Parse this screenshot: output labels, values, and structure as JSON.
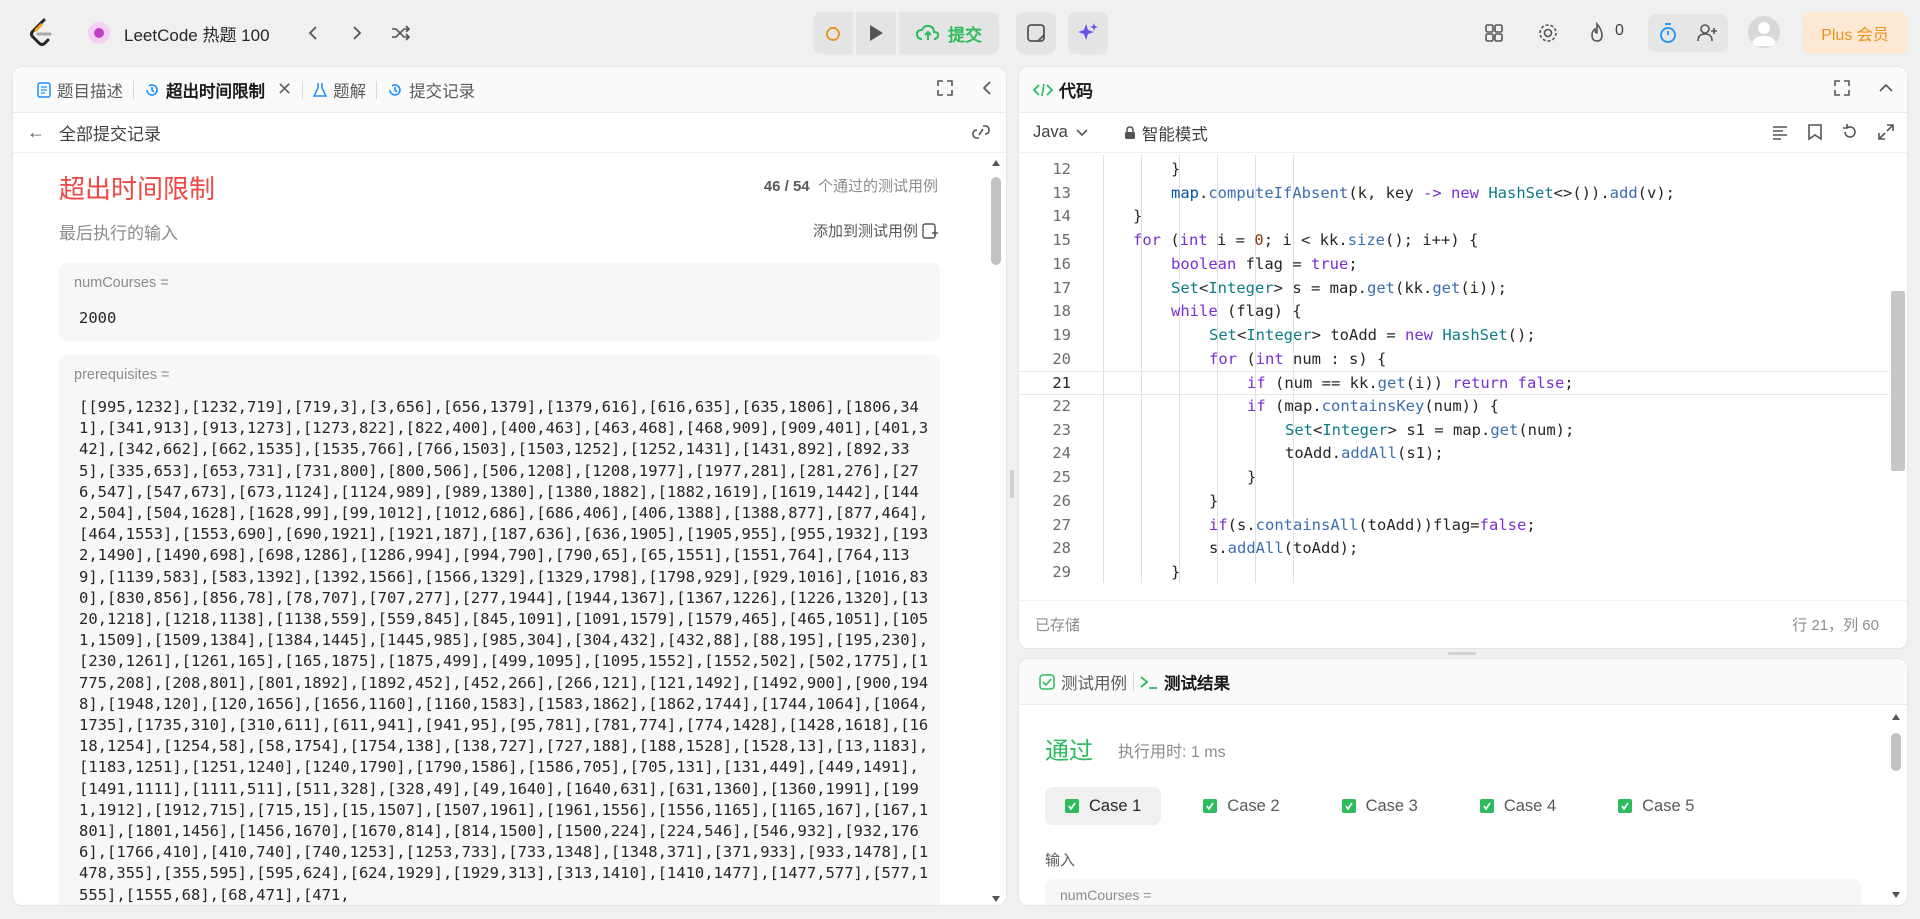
{
  "topbar": {
    "list_title": "LeetCode 热题 100",
    "submit_label": "提交",
    "fire_count": "0",
    "plus_label": "Plus 会员"
  },
  "left": {
    "tabs": [
      {
        "label": "题目描述"
      },
      {
        "label": "超出时间限制"
      },
      {
        "label": "题解"
      },
      {
        "label": "提交记录"
      }
    ],
    "back_label": "全部提交记录",
    "result_title": "超出时间限制",
    "passed": "46 / 54",
    "passed_suffix": "个通过的测试用例",
    "last_input_label": "最后执行的输入",
    "add_case_label": "添加到测试用例",
    "num_label": "numCourses =",
    "num_value": "2000",
    "prereq_label": "prerequisites =",
    "prereq_value": "[[995,1232],[1232,719],[719,3],[3,656],[656,1379],[1379,616],[616,635],[635,1806],[1806,341],[341,913],[913,1273],[1273,822],[822,400],[400,463],[463,468],[468,909],[909,401],[401,342],[342,662],[662,1535],[1535,766],[766,1503],[1503,1252],[1252,1431],[1431,892],[892,335],[335,653],[653,731],[731,800],[800,506],[506,1208],[1208,1977],[1977,281],[281,276],[276,547],[547,673],[673,1124],[1124,989],[989,1380],[1380,1882],[1882,1619],[1619,1442],[1442,504],[504,1628],[1628,99],[99,1012],[1012,686],[686,406],[406,1388],[1388,877],[877,464],[464,1553],[1553,690],[690,1921],[1921,187],[187,636],[636,1905],[1905,955],[955,1932],[1932,1490],[1490,698],[698,1286],[1286,994],[994,790],[790,65],[65,1551],[1551,764],[764,1139],[1139,583],[583,1392],[1392,1566],[1566,1329],[1329,1798],[1798,929],[929,1016],[1016,830],[830,856],[856,78],[78,707],[707,277],[277,1944],[1944,1367],[1367,1226],[1226,1320],[1320,1218],[1218,1138],[1138,559],[559,845],[845,1091],[1091,1579],[1579,465],[465,1051],[1051,1509],[1509,1384],[1384,1445],[1445,985],[985,304],[304,432],[432,88],[88,195],[195,230],[230,1261],[1261,165],[165,1875],[1875,499],[499,1095],[1095,1552],[1552,502],[502,1775],[1775,208],[208,801],[801,1892],[1892,452],[452,266],[266,121],[121,1492],[1492,900],[900,1948],[1948,120],[120,1656],[1656,1160],[1160,1583],[1583,1862],[1862,1744],[1744,1064],[1064,1735],[1735,310],[310,611],[611,941],[941,95],[95,781],[781,774],[774,1428],[1428,1618],[1618,1254],[1254,58],[58,1754],[1754,138],[138,727],[727,188],[188,1528],[1528,13],[13,1183],[1183,1251],[1251,1240],[1240,1790],[1790,1586],[1586,705],[705,131],[131,449],[449,1491],[1491,1111],[1111,511],[511,328],[328,49],[49,1640],[1640,631],[631,1360],[1360,1991],[1991,1912],[1912,715],[715,15],[15,1507],[1507,1961],[1961,1556],[1556,1165],[1165,167],[167,1801],[1801,1456],[1456,1670],[1670,814],[814,1500],[1500,224],[224,546],[546,932],[932,1766],[1766,410],[410,740],[740,1253],[1253,733],[733,1348],[1348,371],[371,933],[933,1478],[1478,355],[355,595],[595,624],[624,1929],[1929,313],[313,1410],[1410,1477],[1477,577],[577,1555],[1555,68],[68,471],[471,"
  },
  "code_panel": {
    "title": "代码",
    "language": "Java",
    "mode": "智能模式",
    "saved": "已存储",
    "cursor": "行 21，列 60",
    "lines": [
      {
        "n": "12",
        "indent": 4,
        "tokens": [
          [
            "pl",
            "}"
          ]
        ]
      },
      {
        "n": "13",
        "indent": 4,
        "tokens": [
          [
            "vr",
            "map"
          ],
          [
            "pl",
            "."
          ],
          [
            "fn",
            "computeIfAbsent"
          ],
          [
            "pl",
            "(k, key "
          ],
          [
            "kw",
            "->"
          ],
          [
            "pl",
            " "
          ],
          [
            "kw",
            "new"
          ],
          [
            "pl",
            " "
          ],
          [
            "ty",
            "HashSet"
          ],
          [
            "pl",
            "<>())."
          ],
          [
            "fn",
            "add"
          ],
          [
            "pl",
            "(v);"
          ]
        ]
      },
      {
        "n": "14",
        "indent": 3,
        "tokens": [
          [
            "pl",
            "}"
          ]
        ]
      },
      {
        "n": "15",
        "indent": 3,
        "tokens": [
          [
            "kw",
            "for"
          ],
          [
            "pl",
            " ("
          ],
          [
            "kw",
            "int"
          ],
          [
            "pl",
            " i = "
          ],
          [
            "nm",
            "0"
          ],
          [
            "pl",
            "; i < kk."
          ],
          [
            "fn",
            "size"
          ],
          [
            "pl",
            "(); i++) {"
          ]
        ]
      },
      {
        "n": "16",
        "indent": 4,
        "tokens": [
          [
            "kw",
            "boolean"
          ],
          [
            "pl",
            " flag = "
          ],
          [
            "kw",
            "true"
          ],
          [
            "pl",
            ";"
          ]
        ]
      },
      {
        "n": "17",
        "indent": 4,
        "tokens": [
          [
            "ty",
            "Set"
          ],
          [
            "pl",
            "<"
          ],
          [
            "ty",
            "Integer"
          ],
          [
            "pl",
            "> s = map."
          ],
          [
            "fn",
            "get"
          ],
          [
            "pl",
            "(kk."
          ],
          [
            "fn",
            "get"
          ],
          [
            "pl",
            "(i));"
          ]
        ]
      },
      {
        "n": "18",
        "indent": 4,
        "tokens": [
          [
            "kw",
            "while"
          ],
          [
            "pl",
            " (flag) {"
          ]
        ]
      },
      {
        "n": "19",
        "indent": 5,
        "tokens": [
          [
            "ty",
            "Set"
          ],
          [
            "pl",
            "<"
          ],
          [
            "ty",
            "Integer"
          ],
          [
            "pl",
            "> toAdd = "
          ],
          [
            "kw",
            "new"
          ],
          [
            "pl",
            " "
          ],
          [
            "ty",
            "HashSet"
          ],
          [
            "pl",
            "();"
          ]
        ]
      },
      {
        "n": "20",
        "indent": 5,
        "tokens": [
          [
            "kw",
            "for"
          ],
          [
            "pl",
            " ("
          ],
          [
            "kw",
            "int"
          ],
          [
            "pl",
            " num : s) {"
          ]
        ]
      },
      {
        "n": "21",
        "indent": 6,
        "tokens": [
          [
            "kw",
            "if"
          ],
          [
            "pl",
            " (num == kk."
          ],
          [
            "fn",
            "get"
          ],
          [
            "pl",
            "(i)) "
          ],
          [
            "kw",
            "return"
          ],
          [
            "pl",
            " "
          ],
          [
            "kw",
            "false"
          ],
          [
            "pl",
            ";"
          ]
        ]
      },
      {
        "n": "22",
        "indent": 6,
        "tokens": [
          [
            "kw",
            "if"
          ],
          [
            "pl",
            " (map."
          ],
          [
            "fn",
            "containsKey"
          ],
          [
            "pl",
            "(num)) {"
          ]
        ]
      },
      {
        "n": "23",
        "indent": 7,
        "tokens": [
          [
            "ty",
            "Set"
          ],
          [
            "pl",
            "<"
          ],
          [
            "ty",
            "Integer"
          ],
          [
            "pl",
            "> s1 = map."
          ],
          [
            "fn",
            "get"
          ],
          [
            "pl",
            "(num);"
          ]
        ]
      },
      {
        "n": "24",
        "indent": 7,
        "tokens": [
          [
            "pl",
            "toAdd."
          ],
          [
            "fn",
            "addAll"
          ],
          [
            "pl",
            "(s1);"
          ]
        ]
      },
      {
        "n": "25",
        "indent": 6,
        "tokens": [
          [
            "pl",
            "}"
          ]
        ]
      },
      {
        "n": "26",
        "indent": 5,
        "tokens": [
          [
            "pl",
            "}"
          ]
        ]
      },
      {
        "n": "27",
        "indent": 5,
        "tokens": [
          [
            "kw",
            "if"
          ],
          [
            "pl",
            "(s."
          ],
          [
            "fn",
            "containsAll"
          ],
          [
            "pl",
            "(toAdd))flag="
          ],
          [
            "kw",
            "false"
          ],
          [
            "pl",
            ";"
          ]
        ]
      },
      {
        "n": "28",
        "indent": 5,
        "tokens": [
          [
            "pl",
            "s."
          ],
          [
            "fn",
            "addAll"
          ],
          [
            "pl",
            "(toAdd);"
          ]
        ]
      },
      {
        "n": "29",
        "indent": 4,
        "tokens": [
          [
            "pl",
            "}"
          ]
        ]
      }
    ]
  },
  "test_panel": {
    "tab_cases": "测试用例",
    "tab_result": "测试结果",
    "status": "通过",
    "runtime": "执行用时: 1 ms",
    "cases": [
      "Case 1",
      "Case 2",
      "Case 3",
      "Case 4",
      "Case 5"
    ],
    "input_label": "输入",
    "input_first": "numCourses ="
  }
}
